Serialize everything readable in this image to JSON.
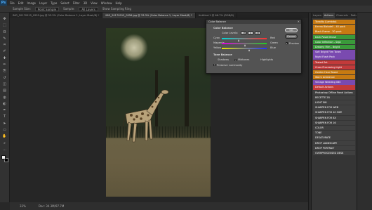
{
  "app": {
    "logo": "Ps"
  },
  "menu": [
    "File",
    "Edit",
    "Image",
    "Layer",
    "Type",
    "Select",
    "Filter",
    "3D",
    "View",
    "Window",
    "Help"
  ],
  "options": {
    "items": [
      "Sample Size:",
      "Point Sample",
      "Sample:",
      "All Layers",
      "Show Sampling Ring"
    ]
  },
  "tabs": [
    {
      "label": "IMG_20170915_0955.jpg @ 33.3% (Color Balance 1, Layer Mask/8) *",
      "active": false
    },
    {
      "label": "IMG_20170915_0956.jpg @ 33.3% (Color Balance 1, Layer Mask/8) *",
      "active": true
    },
    {
      "label": "Untitled-1 @ 66.7% (RGB/8)",
      "active": false
    }
  ],
  "tools": [
    "move",
    "marquee",
    "lasso",
    "quick-select",
    "crop",
    "eyedropper",
    "healing",
    "brush",
    "clone",
    "history-brush",
    "eraser",
    "gradient",
    "blur",
    "dodge",
    "pen",
    "type",
    "path-select",
    "shape",
    "hand",
    "zoom",
    "more"
  ],
  "tool_glyphs": [
    "✥",
    "⬚",
    "ʘ",
    "✎",
    "⌗",
    "✐",
    "✚",
    "✏",
    "⎘",
    "↺",
    "◫",
    "▤",
    "◍",
    "◐",
    "✒",
    "T",
    "➤",
    "▭",
    "✋",
    "⌕",
    "…"
  ],
  "status": {
    "zoom": "33%",
    "doc": "Doc: 34.3M/97.7M"
  },
  "panels": {
    "tabs": [
      {
        "label": "Layers",
        "active": false
      },
      {
        "label": "Actions",
        "active": true
      },
      {
        "label": "Channels",
        "active": false
      },
      {
        "label": "Paths",
        "active": false
      },
      {
        "label": "History",
        "active": false
      }
    ],
    "actions": [
      {
        "label": "Tonality (Lambda)",
        "color": "#c77a12"
      },
      {
        "label": "Emma Blaisdell - 40 pack",
        "color": "#c77a12"
      },
      {
        "label": "Black Frame - 30 pack",
        "color": "#c77a12"
      },
      {
        "label": "Dark Pastel Brush",
        "color": "#3a9a3a"
      },
      {
        "label": "Color Inflection - Sept",
        "color": "#3a9a3a"
      },
      {
        "label": "Dreamy Film - Bright",
        "color": "#3a9a3a"
      },
      {
        "label": "Soft Bright Film Tones",
        "color": "#7a4ab0"
      },
      {
        "label": "Night Flash Pack",
        "color": "#7a4ab0"
      },
      {
        "label": "Tested Set",
        "color": "#c23a3a"
      },
      {
        "label": "Cross Processing Light",
        "color": "#c23a3a"
      },
      {
        "label": "Golden Hour Boost",
        "color": "#c77a12"
      },
      {
        "label": "Warm Ambience",
        "color": "#c77a12"
      },
      {
        "label": "Vintage Wedding 080",
        "color": "#7a4ab0"
      },
      {
        "label": "Default Actions",
        "color": "#c23a3a"
      },
      {
        "label": "Photoshop Offline Panel Actions",
        "color": "#404040"
      },
      {
        "label": "RECETTE 2B",
        "color": "#404040"
      },
      {
        "label": "LIGHT BM",
        "color": "#404040"
      },
      {
        "label": "SHARPEN FOR WEB",
        "color": "#404040"
      },
      {
        "label": "SHARPEN FOR 40 SIZE",
        "color": "#404040"
      },
      {
        "label": "SHARPEN FOR 8X",
        "color": "#404040"
      },
      {
        "label": "SHARPEN FOR 16",
        "color": "#404040"
      },
      {
        "label": "COLOR",
        "color": "#404040"
      },
      {
        "label": "TONE",
        "color": "#404040"
      },
      {
        "label": "DESATURATE",
        "color": "#404040"
      },
      {
        "label": "DROP LANDSCAPE",
        "color": "#404040"
      },
      {
        "label": "DROP PORTRAIT",
        "color": "#404040"
      },
      {
        "label": "OVERPROCESSED DESK",
        "color": "#404040"
      }
    ]
  },
  "dialog": {
    "title": "Color Balance",
    "group_color": "Color Balance",
    "levels_label": "Color Levels:",
    "levels": [
      "-16",
      "4",
      "16"
    ],
    "sliders": [
      {
        "left": "Cyan",
        "right": "Red",
        "value_fraction": 0.38
      },
      {
        "left": "Magenta",
        "right": "Green",
        "value_fraction": 0.53
      },
      {
        "left": "Yellow",
        "right": "Blue",
        "value_fraction": 0.62
      }
    ],
    "group_tone": "Tone Balance",
    "tones": {
      "shadows": "Shadows",
      "midtones": "Midtones",
      "highlights": "Highlights",
      "selected": "midtones"
    },
    "preserve_label": "Preserve Luminosity",
    "ok": "OK",
    "cancel": "Cancel",
    "preview": "Preview"
  }
}
